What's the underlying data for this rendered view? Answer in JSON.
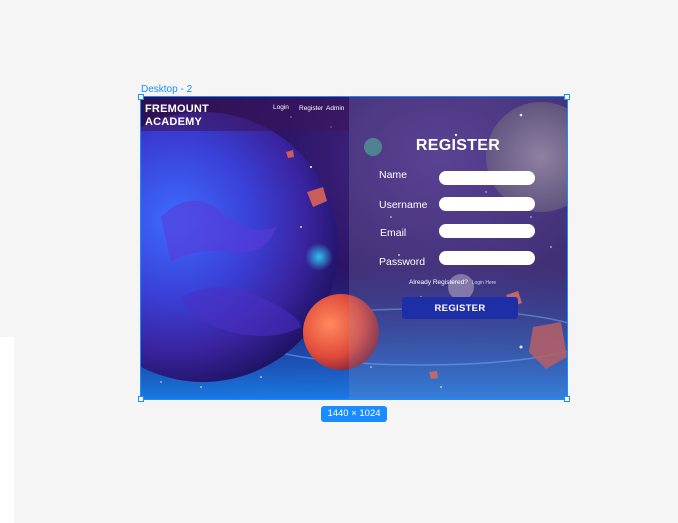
{
  "canvas": {
    "frame_label": "Desktop - 2",
    "size_badge": "1440 × 1024",
    "accent_color": "#1a8cff"
  },
  "header": {
    "brand_line1": "FREMOUNT",
    "brand_line2": "ACADEMY",
    "nav": {
      "login": "Login",
      "register": "Register",
      "admin": "Admin"
    }
  },
  "form": {
    "title": "REGISTER",
    "fields": [
      {
        "label": "Name",
        "value": ""
      },
      {
        "label": "Username",
        "value": ""
      },
      {
        "label": "Email",
        "value": ""
      },
      {
        "label": "Password",
        "value": ""
      }
    ],
    "already_text": "Already Registered?",
    "login_link": "Login Here",
    "submit_label": "REGISTER",
    "button_color": "#1d2ea6"
  }
}
